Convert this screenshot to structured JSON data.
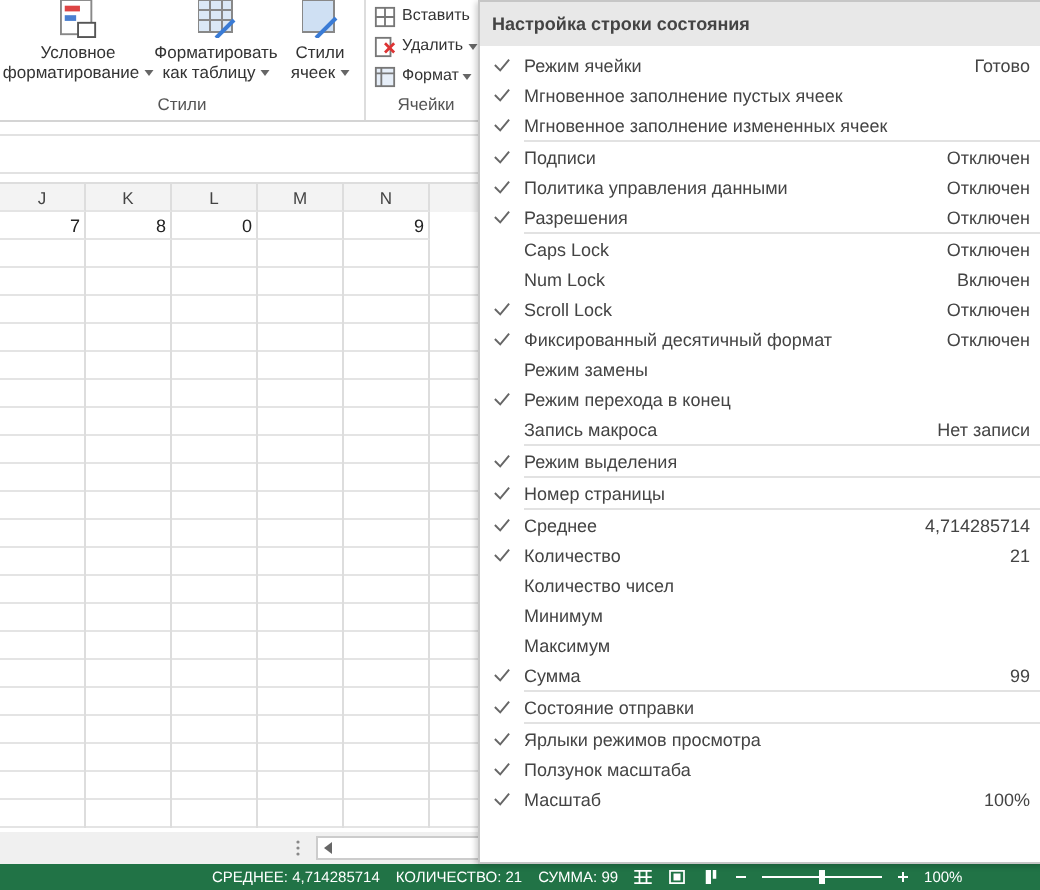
{
  "ribbon": {
    "groups": [
      {
        "label": "Стили",
        "buttons": [
          {
            "label": "Условное форматирование",
            "dropdown": true
          },
          {
            "label": "Форматировать как таблицу",
            "dropdown": true
          },
          {
            "label": "Стили ячеек",
            "dropdown": true
          }
        ]
      },
      {
        "label": "Ячейки",
        "buttons": [
          {
            "label": "Вставить",
            "dropdown": false
          },
          {
            "label": "Удалить",
            "dropdown": true
          },
          {
            "label": "Формат",
            "dropdown": true
          }
        ]
      }
    ]
  },
  "sheet": {
    "columns": [
      "J",
      "K",
      "L",
      "M",
      "N"
    ],
    "rows": [
      [
        "7",
        "8",
        "0",
        "",
        "9"
      ]
    ]
  },
  "menu": {
    "title": "Настройка строки состояния",
    "groups": [
      [
        {
          "label": "Режим ячейки",
          "checked": true,
          "value": "Готово"
        },
        {
          "label": "Мгновенное заполнение пустых ячеек",
          "checked": true
        },
        {
          "label": "Мгновенное заполнение измененных ячеек",
          "checked": true
        }
      ],
      [
        {
          "label": "Подписи",
          "checked": true,
          "value": "Отключен"
        },
        {
          "label": "Политика управления данными",
          "checked": true,
          "value": "Отключен"
        },
        {
          "label": "Разрешения",
          "checked": true,
          "value": "Отключен"
        }
      ],
      [
        {
          "label": "Caps Lock",
          "checked": false,
          "value": "Отключен"
        },
        {
          "label": "Num Lock",
          "checked": false,
          "value": "Включен"
        },
        {
          "label": "Scroll Lock",
          "checked": true,
          "value": "Отключен"
        },
        {
          "label": "Фиксированный десятичный формат",
          "checked": true,
          "value": "Отключен"
        },
        {
          "label": "Режим замены",
          "checked": false
        },
        {
          "label": "Режим перехода  в конец",
          "checked": true
        },
        {
          "label": "Запись макроса",
          "checked": false,
          "value": "Нет записи"
        }
      ],
      [
        {
          "label": "Режим выделения",
          "checked": true
        }
      ],
      [
        {
          "label": "Номер страницы",
          "checked": true
        }
      ],
      [
        {
          "label": "Среднее",
          "checked": true,
          "value": "4,714285714"
        },
        {
          "label": "Количество",
          "checked": true,
          "value": "21"
        },
        {
          "label": "Количество чисел",
          "checked": false
        },
        {
          "label": "Минимум",
          "checked": false
        },
        {
          "label": "Максимум",
          "checked": false
        },
        {
          "label": "Сумма",
          "checked": true,
          "value": "99"
        }
      ],
      [
        {
          "label": "Состояние отправки",
          "checked": true
        }
      ],
      [
        {
          "label": "Ярлыки режимов просмотра",
          "checked": true
        },
        {
          "label": "Ползунок масштаба",
          "checked": true
        },
        {
          "label": "Масштаб",
          "checked": true,
          "value": "100%"
        }
      ]
    ]
  },
  "status_bar": {
    "stats": [
      "СРЕДНЕЕ: 4,714285714",
      "КОЛИЧЕСТВО: 21",
      "СУММА: 99"
    ],
    "zoom": "100%",
    "zoom_slider": {
      "level": 0.5
    }
  }
}
